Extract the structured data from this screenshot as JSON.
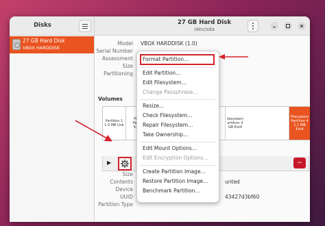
{
  "sidebar": {
    "title": "Disks",
    "disk": {
      "name": "27 GB Hard Disk",
      "model": "VBOX HARDDISK"
    }
  },
  "header": {
    "title": "27 GB Hard Disk",
    "subtitle": "/dev/sda"
  },
  "disk_info": {
    "labels": [
      "Model",
      "Serial Number",
      "Assessment",
      "Size",
      "Partitioning"
    ],
    "model_value": "VBOX HARDDISK (1.0)"
  },
  "volumes": {
    "title": "Volumes",
    "segments": [
      {
        "lines": [
          "Partition 1",
          "1.0 MB Unk"
        ]
      },
      {
        "lines": [
          "File",
          "Parti",
          "538"
        ]
      },
      {
        "lines": [
          "ilesystem",
          "artition 3",
          "GB Ext4"
        ]
      },
      {
        "lines": [
          "Filesystem",
          "Partition 4",
          "1.1 MB Ext4"
        ]
      }
    ],
    "minus_symbol": "−"
  },
  "volume_info": {
    "labels": [
      "Size",
      "Contents",
      "Device",
      "UUID",
      "Partition Type"
    ],
    "contents_value": "unted",
    "uuid_value": "43427d3bf60"
  },
  "context_menu": {
    "items": [
      {
        "label": "Format Partition…",
        "enabled": true
      },
      {
        "label": "Edit Partition…",
        "enabled": true
      },
      {
        "label": "Edit Filesystem…",
        "enabled": true
      },
      {
        "label": "Change Passphrase…",
        "enabled": false
      },
      {
        "label": "Resize…",
        "enabled": true
      },
      {
        "label": "Check Filesystem…",
        "enabled": true
      },
      {
        "label": "Repair Filesystem…",
        "enabled": true
      },
      {
        "label": "Take Ownership…",
        "enabled": true
      },
      {
        "label": "Edit Mount Options…",
        "enabled": true
      },
      {
        "label": "Edit Encryption Options…",
        "enabled": false
      },
      {
        "label": "Create Partition Image…",
        "enabled": true
      },
      {
        "label": "Restore Partition Image…",
        "enabled": true
      },
      {
        "label": "Benchmark Partition…",
        "enabled": true
      }
    ]
  },
  "colors": {
    "accent": "#e95420",
    "annotation_red": "#d4222a",
    "destructive": "#c7162b"
  },
  "icons": [
    "hamburger-menu-icon",
    "vertical-dots-icon",
    "minimize-icon",
    "maximize-icon",
    "close-icon",
    "hard-disk-icon",
    "play-icon",
    "gear-icon",
    "arrow-icon"
  ]
}
